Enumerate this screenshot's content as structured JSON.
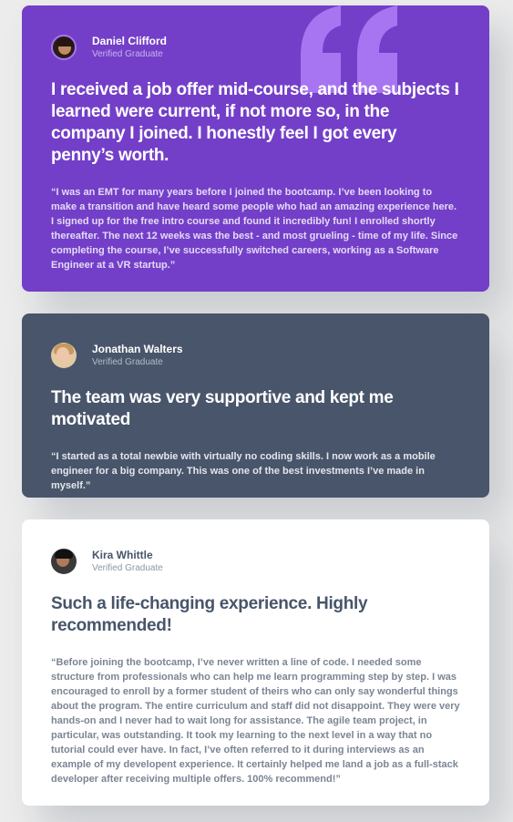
{
  "theme": {
    "page_background": "#ececec",
    "violet": "#733fc8",
    "grayish_blue": "#48556a",
    "white": "#ffffff",
    "quote_mark": "#a775f1"
  },
  "testimonials": [
    {
      "author": "Daniel Clifford",
      "status": "Verified Graduate",
      "headline": "I received a job offer mid-course, and the subjects I learned were current, if not more so, in the company I joined. I honestly feel I got every penny’s worth.",
      "body": "“I was an EMT for many years before I joined the bootcamp. I’ve been looking to make a transition and have heard some people who had an amazing experience here. I signed up for the free intro course and found it incredibly fun! I enrolled shortly thereafter. The next 12 weeks was the best - and most grueling - time of my life. Since completing the course, I’ve successfully switched careers, working as a Software Engineer at a VR startup.”"
    },
    {
      "author": "Jonathan Walters",
      "status": "Verified Graduate",
      "headline": "The team was very supportive and kept me motivated",
      "body": "“I started as a total newbie with virtually no coding skills. I now work as a mobile engineer for a big company. This was one of the best investments I’ve made in myself.”"
    },
    {
      "author": "Kira Whittle",
      "status": "Verified Graduate",
      "headline": "Such a life-changing experience. Highly recommended!",
      "body": "“Before joining the bootcamp, I’ve never written a line of code. I needed some structure from professionals who can help me learn programming step by step. I was encouraged to enroll by a former student of theirs who can only say wonderful things about the program. The entire curriculum and staff did not disappoint. They were very hands-on and I never had to wait long for assistance. The agile team project, in particular, was outstanding. It took my learning to the next level in a way that no tutorial could ever have. In fact, I’ve often referred to it during interviews as an example of my developent experience. It certainly helped me land a job as a full-stack developer after receiving multiple offers. 100% recommend!”"
    }
  ]
}
